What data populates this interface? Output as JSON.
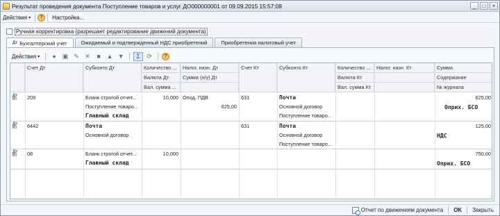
{
  "window": {
    "title": "Результат проведения документа Поступление товаров и услуг ДО000000001 от 09.09.2015 15:57:08",
    "controls": [
      "_",
      "□",
      "×"
    ]
  },
  "menubar": {
    "actions": "Действия",
    "help": "?",
    "settings": "Настройка..."
  },
  "manual_adjust": {
    "label": "Ручная корректировка (разрешает редактирование движений документа)",
    "checked": false
  },
  "tabs": [
    {
      "label": "Бухгалтерский учет",
      "active": true
    },
    {
      "label": "Ожидаемый и подтвержденный НДС приобретений",
      "active": false
    },
    {
      "label": "Приобретения налоговый учет",
      "active": false
    }
  ],
  "toolbar": {
    "actions": "Действия",
    "help": "?"
  },
  "table": {
    "headers": {
      "schet_dt": "Счет Дт",
      "subkonto_dt": "Субконто Дт",
      "kolichestvo_dt": "Количество ...",
      "valuta_dt": "Валюта Дт",
      "val_summa_dt": "Вал. сумма ...",
      "nalog_dt": "Налог. назн. Дт",
      "summa_nu_dt": "Сумма (н/у) Дт",
      "schet_kt": "Счет Кт",
      "subkonto_kt": "Субконто Кт",
      "kolichestvo_kt": "Количество ...",
      "valuta_kt": "Валюта Кт",
      "val_summa_kt": "Вал. сумма Кт",
      "nalog_kt": "Налог. назн. Кт",
      "summa": "Сумма",
      "soderzhanie": "Содержание",
      "zhurnal": "№ журнала"
    },
    "rows": [
      {
        "schet_dt": "209",
        "subkonto_dt": [
          "Бланк строгой отчет...",
          "Поступление товаро...",
          "Главный склад"
        ],
        "kolichestvo_dt": "10,000",
        "nalog_dt": "Опод. ПДВ",
        "summa_nu_dt": "625,00",
        "schet_kt": "631",
        "subkonto_kt": [
          "Почта",
          "Основной договор",
          "Поступление товаро..."
        ],
        "summa": "625,00",
        "soderzhanie": "Оприх. БСО"
      },
      {
        "schet_dt": "6442",
        "subkonto_dt": [
          "Почта",
          "Основной договор",
          ""
        ],
        "kolichestvo_dt": "",
        "nalog_dt": "",
        "summa_nu_dt": "",
        "schet_kt": "631",
        "subkonto_kt": [
          "Почта",
          "Основной договор",
          "Поступление товаро..."
        ],
        "summa": "125,00",
        "soderzhanie": "НДС"
      },
      {
        "schet_dt": "08",
        "subkonto_dt": [
          "Бланк строгой отчет...",
          "Главный склад",
          ""
        ],
        "kolichestvo_dt": "10,000",
        "nalog_dt": "",
        "summa_nu_dt": "",
        "schet_kt": "",
        "subkonto_kt": [
          "",
          "",
          ""
        ],
        "summa": "750,00",
        "soderzhanie": "Оприх. БСО"
      }
    ]
  },
  "statusbar": {
    "report": "Отчет по движениям документа",
    "ok": "OK",
    "close": "Закрыть"
  },
  "icons": {
    "app": "1c-app-icon",
    "row": "dt-kt-entry-icon"
  }
}
